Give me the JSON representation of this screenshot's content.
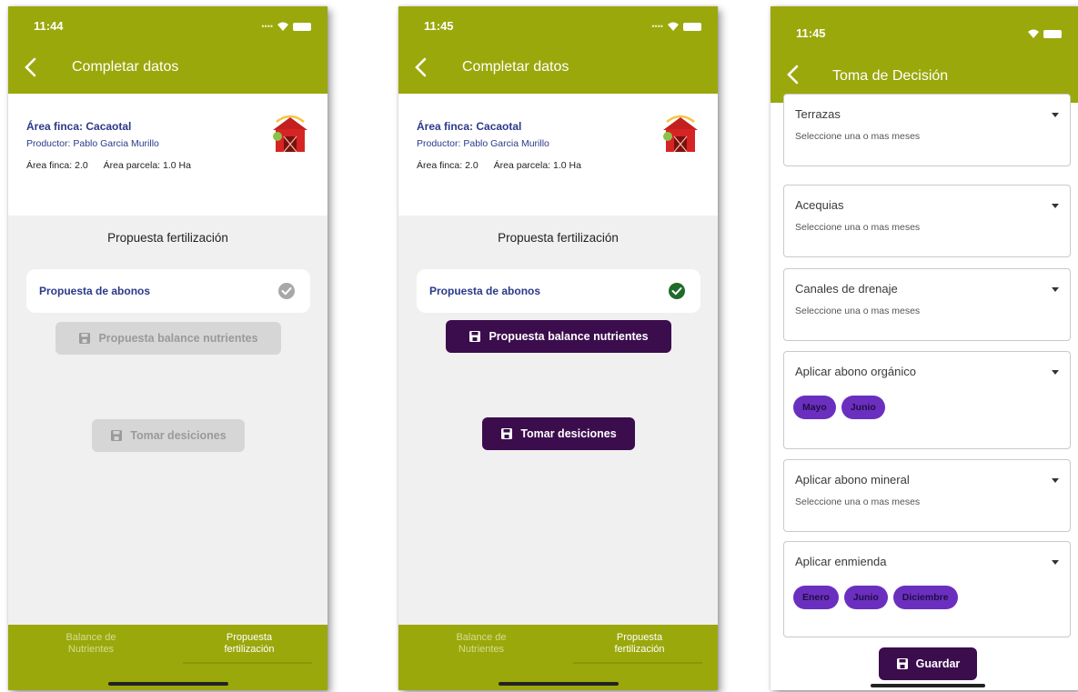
{
  "colors": {
    "brand_green": "#9aa80c",
    "primary_dark": "#3b0d4d",
    "chip_purple": "#6b2fc0",
    "link_blue": "#2a3a8a",
    "check_green": "#1f6b2a"
  },
  "screen1": {
    "time": "11:44",
    "title": "Completar datos",
    "farm_name": "Área finca: Cacaotal",
    "producer": "Productor: Pablo Garcia Murillo",
    "area_finca": "Área finca: 2.0",
    "area_parcela": "Área parcela: 1.0 Ha",
    "section_title": "Propuesta fertilización",
    "proposal_label": "Propuesta de abonos",
    "balance_button": "Propuesta balance nutrientes",
    "decisions_button": "Tomar desiciones",
    "tabs": [
      {
        "line1": "Balance de",
        "line2": "Nutrientes"
      },
      {
        "line1": "Propuesta",
        "line2": "fertilización"
      }
    ]
  },
  "screen2": {
    "time": "11:45",
    "title": "Completar datos",
    "farm_name": "Área finca: Cacaotal",
    "producer": "Productor: Pablo Garcia Murillo",
    "area_finca": "Área finca: 2.0",
    "area_parcela": "Área parcela: 1.0 Ha",
    "section_title": "Propuesta fertilización",
    "proposal_label": "Propuesta de abonos",
    "balance_button": "Propuesta balance nutrientes",
    "decisions_button": "Tomar desiciones",
    "tabs": [
      {
        "line1": "Balance de",
        "line2": "Nutrientes"
      },
      {
        "line1": "Propuesta",
        "line2": "fertilización"
      }
    ]
  },
  "screen3": {
    "time": "11:45",
    "title": "Toma de Decisión",
    "fields": [
      {
        "label": "Terrazas",
        "placeholder": "Seleccione una o mas meses",
        "chips": []
      },
      {
        "label": "Acequias",
        "placeholder": "Seleccione una o mas meses",
        "chips": []
      },
      {
        "label": "Canales de drenaje",
        "placeholder": "Seleccione una o mas meses",
        "chips": []
      },
      {
        "label": "Aplicar abono orgánico",
        "placeholder": "",
        "chips": [
          "Mayo",
          "Junio"
        ]
      },
      {
        "label": "Aplicar abono mineral",
        "placeholder": "Seleccione una o mas meses",
        "chips": []
      },
      {
        "label": "Aplicar enmienda",
        "placeholder": "",
        "chips": [
          "Enero",
          "Junio",
          "Diciembre"
        ]
      }
    ],
    "save_button": "Guardar"
  }
}
